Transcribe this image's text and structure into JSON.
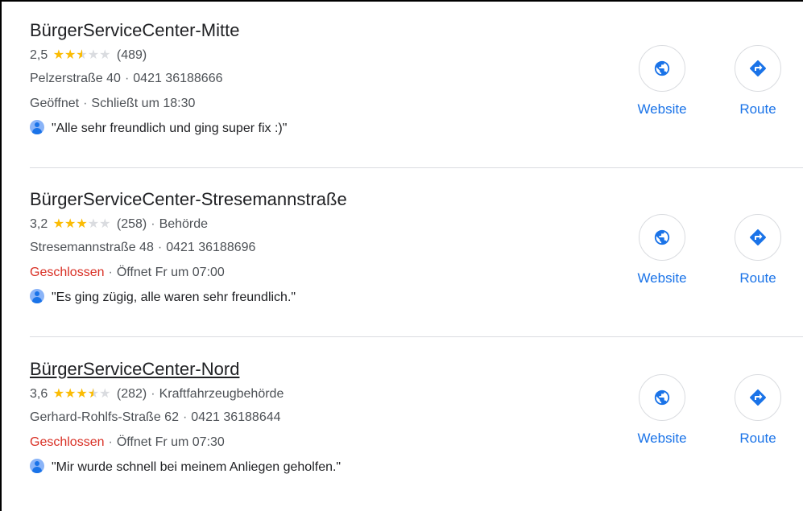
{
  "listings": [
    {
      "name": "BürgerServiceCenter-Mitte",
      "rating": "2,5",
      "stars": 2.5,
      "reviews": "(489)",
      "category": "",
      "address": "Pelzerstraße 40",
      "phone": "0421 36188666",
      "status": "Geöffnet",
      "status_closed": false,
      "hours": "Schließt um 18:30",
      "review_snippet": "\"Alle sehr freundlich und ging super fix :)\"",
      "website_label": "Website",
      "route_label": "Route"
    },
    {
      "name": "BürgerServiceCenter-Stresemannstraße",
      "rating": "3,2",
      "stars": 3,
      "reviews": "(258)",
      "category": "Behörde",
      "address": "Stresemannstraße 48",
      "phone": "0421 36188696",
      "status": "Geschlossen",
      "status_closed": true,
      "hours": "Öffnet Fr um 07:00",
      "review_snippet": "\"Es ging zügig, alle waren sehr freundlich.\"",
      "website_label": "Website",
      "route_label": "Route"
    },
    {
      "name": "BürgerServiceCenter-Nord",
      "rating": "3,6",
      "stars": 3.5,
      "reviews": "(282)",
      "category": "Kraftfahrzeugbehörde",
      "address": "Gerhard-Rohlfs-Straße 62",
      "phone": "0421 36188644",
      "status": "Geschlossen",
      "status_closed": true,
      "hours": "Öffnet Fr um 07:30",
      "review_snippet": "\"Mir wurde schnell bei meinem Anliegen geholfen.\"",
      "website_label": "Website",
      "route_label": "Route"
    }
  ],
  "icons": {
    "website": "globe-icon",
    "route": "directions-icon",
    "reviewer": "person-avatar-icon"
  },
  "colors": {
    "star": "#fbbc04",
    "link": "#1a73e8",
    "closed": "#d93025",
    "divider": "#dadce0"
  }
}
